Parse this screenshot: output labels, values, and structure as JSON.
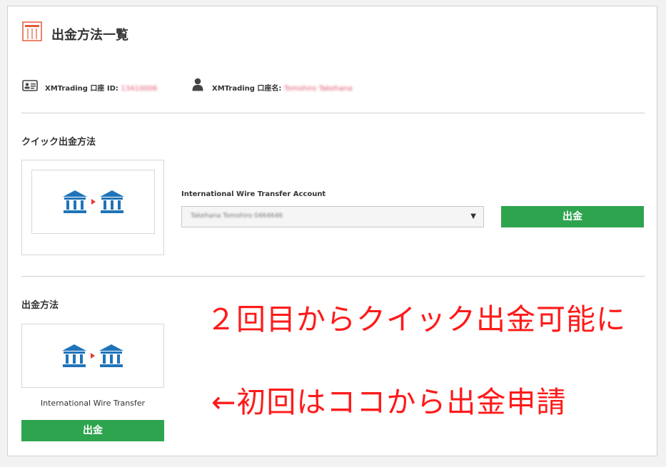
{
  "header": {
    "title": "出金方法一覧",
    "icon": "withdrawal-list-icon"
  },
  "account": {
    "id_label": "XMTrading 口座 ID:",
    "id_value": "13410006",
    "name_label": "XMTrading 口座名:",
    "name_value": "Tomohiro Takehana"
  },
  "quick": {
    "section_title": "クイック出金方法",
    "field_label": "International Wire Transfer Account",
    "select_value": "Takehana Tomohiro 0464646",
    "button_label": "出金"
  },
  "methods": {
    "section_title": "出金方法",
    "items": [
      {
        "caption": "International Wire Transfer",
        "button_label": "出金"
      }
    ]
  },
  "annotations": {
    "line1": "２回目からクイック出金可能に",
    "line2": "←初回はココから出金申請"
  },
  "colors": {
    "accent_green": "#2ea44f",
    "icon_blue": "#1f74b9",
    "annotation_red": "#ff1a1a",
    "arrow_red": "#e53935"
  }
}
